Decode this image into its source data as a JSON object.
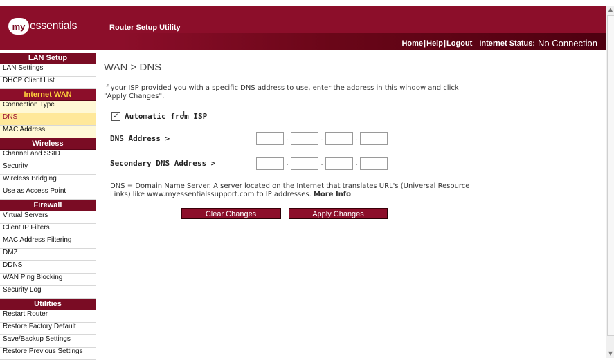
{
  "header": {
    "logo_my": "my",
    "logo_text": "essentials",
    "app_title": "Router Setup Utility",
    "links": {
      "home": "Home",
      "help": "Help",
      "logout": "Logout",
      "separator": "|"
    },
    "status_label": "Internet Status:",
    "status_value": "No Connection"
  },
  "sidebar": {
    "sections": [
      {
        "title": "LAN Setup",
        "items": [
          "LAN Settings",
          "DHCP Client List"
        ]
      },
      {
        "title": "Internet WAN",
        "items": [
          "Connection Type",
          "DNS",
          "MAC Address"
        ]
      },
      {
        "title": "Wireless",
        "items": [
          "Channel and SSID",
          "Security",
          "Wireless Bridging",
          "Use as Access Point"
        ]
      },
      {
        "title": "Firewall",
        "items": [
          "Virtual Servers",
          "Client IP Filters",
          "MAC Address Filtering",
          "DMZ",
          "DDNS",
          "WAN Ping Blocking",
          "Security Log"
        ]
      },
      {
        "title": "Utilities",
        "items": [
          "Restart Router",
          "Restore Factory Default",
          "Save/Backup Settings",
          "Restore Previous Settings"
        ]
      }
    ]
  },
  "main": {
    "title": "WAN > DNS",
    "intro": "If your ISP provided you with a specific DNS address to use, enter the address in this window and click \"Apply Changes\".",
    "auto_checked": true,
    "auto_label": "Automatic from ISP",
    "dns_label": "DNS Address >",
    "secondary_dns_label": "Secondary DNS Address >",
    "dns_octets": [
      "",
      "",
      "",
      ""
    ],
    "secondary_dns_octets": [
      "",
      "",
      "",
      ""
    ],
    "octet_dot": ".",
    "note": "DNS = Domain Name Server. A server located on the Internet that translates URL's (Universal Resource Links) like www.myessentialssupport.com to IP addresses.",
    "more_info": "More Info",
    "clear_button": "Clear Changes",
    "apply_button": "Apply Changes"
  },
  "colors": {
    "brand": "#8c0e2a",
    "active_section_text": "#ffd23c",
    "selected_item_bg": "#ffe89a"
  },
  "icons": {
    "checkbox": "check-icon",
    "cursor": "text-cursor-icon",
    "scroll_up": "arrow-up-icon",
    "scroll_down": "arrow-down-icon"
  }
}
